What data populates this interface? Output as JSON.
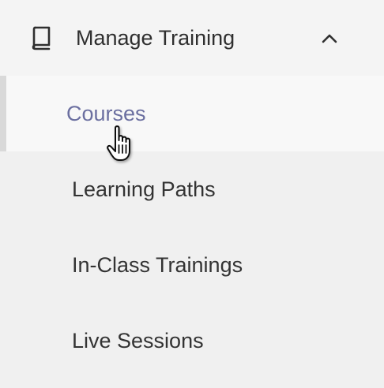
{
  "menu": {
    "header": {
      "label": "Manage Training",
      "icon": "book-icon",
      "toggle_icon": "chevron-up-icon",
      "expanded": true
    },
    "items": [
      {
        "label": "Courses",
        "active": true
      },
      {
        "label": "Learning Paths",
        "active": false
      },
      {
        "label": "In-Class Trainings",
        "active": false
      },
      {
        "label": "Live Sessions",
        "active": false
      }
    ],
    "colors": {
      "active_text": "#6b6fa0",
      "text": "#333333",
      "background": "#f0f0f0",
      "active_background": "#f8f8f8"
    }
  },
  "cursor": {
    "icon": "hand-pointer-icon"
  }
}
